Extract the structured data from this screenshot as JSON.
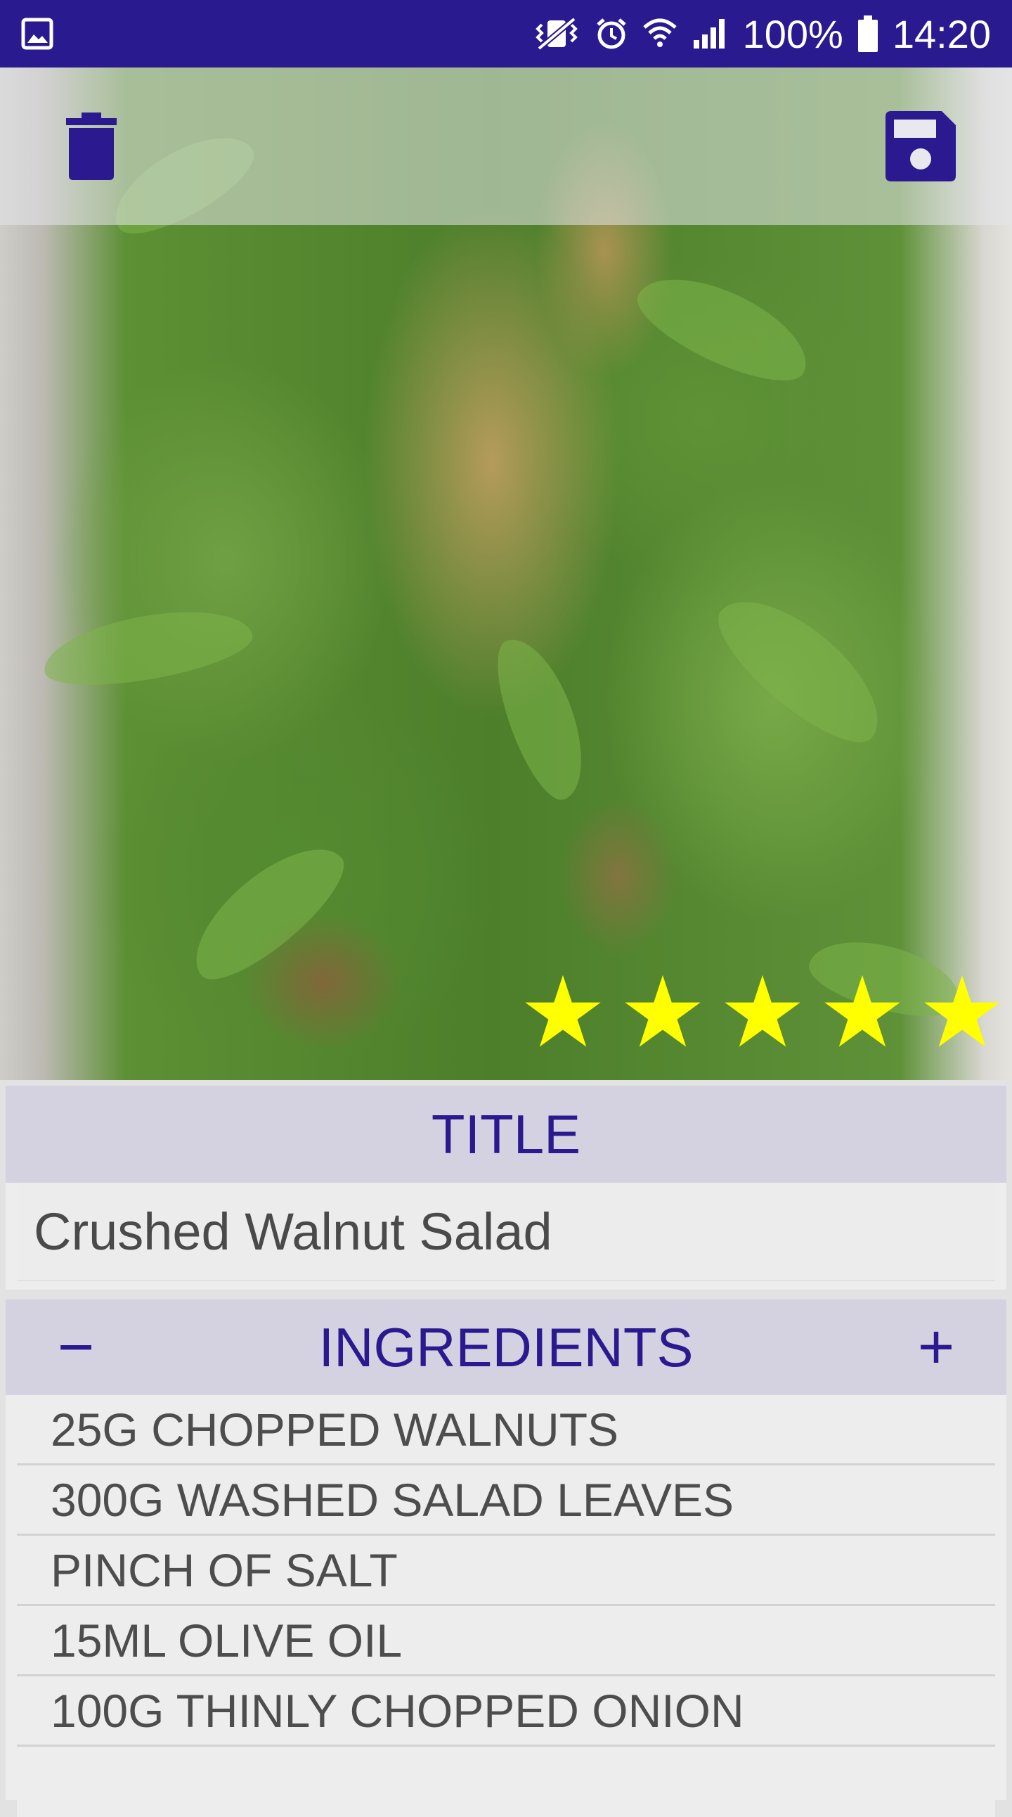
{
  "status_bar": {
    "battery_percent": "100%",
    "time": "14:20",
    "icons": [
      "gallery-icon",
      "vibrate-icon",
      "alarm-icon",
      "wifi-icon",
      "signal-icon",
      "battery-icon"
    ]
  },
  "toolbar": {
    "delete_icon": "trash-icon",
    "save_icon": "floppy-disk-icon"
  },
  "rating": {
    "stars": 5,
    "max": 5,
    "star_color": "#ffff00"
  },
  "title_section": {
    "header": "TITLE",
    "value": "Crushed Walnut Salad"
  },
  "ingredients_section": {
    "header": "INGREDIENTS",
    "minus_label": "−",
    "plus_label": "+",
    "items": [
      "25G CHOPPED WALNUTS",
      "300G WASHED SALAD LEAVES",
      "PINCH OF SALT",
      "15ML OLIVE OIL",
      "100G THINLY CHOPPED ONION",
      ""
    ]
  },
  "colors": {
    "accent": "#2b1a8f",
    "status_bar": "#2a1a8f",
    "header_bg": "#d4d1e1",
    "card_bg": "#ededed"
  }
}
